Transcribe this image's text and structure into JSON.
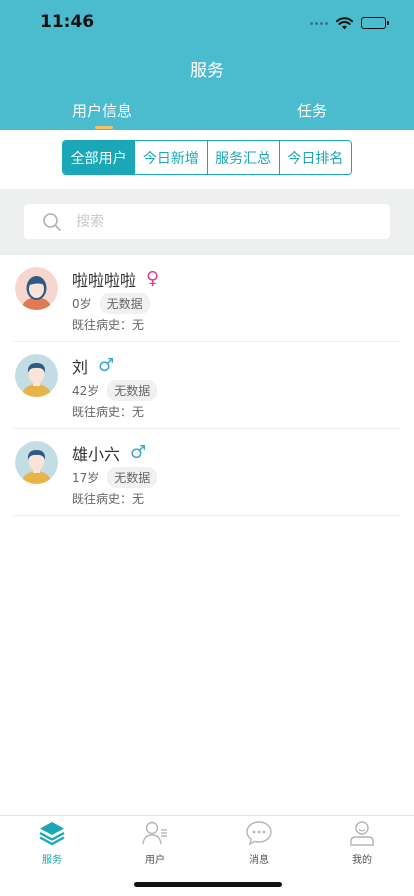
{
  "status_bar": {
    "time": "11:46"
  },
  "nav": {
    "title": "服务"
  },
  "top_tabs": [
    {
      "label": "用户信息",
      "active": true
    },
    {
      "label": "任务",
      "active": false
    }
  ],
  "segments": [
    {
      "label": "全部用户",
      "active": true
    },
    {
      "label": "今日新增",
      "active": false
    },
    {
      "label": "服务汇总",
      "active": false
    },
    {
      "label": "今日排名",
      "active": false
    }
  ],
  "search": {
    "placeholder": "搜索",
    "value": ""
  },
  "users": [
    {
      "name": "啦啦啦啦",
      "gender_symbol": "♀",
      "gender": "female",
      "age": "0岁",
      "badge": "无数据",
      "history": "既往病史：无"
    },
    {
      "name": "刘",
      "gender_symbol": "♂",
      "gender": "male",
      "age": "42岁",
      "badge": "无数据",
      "history": "既往病史：无"
    },
    {
      "name": "雄小六",
      "gender_symbol": "♂",
      "gender": "male",
      "age": "17岁",
      "badge": "无数据",
      "history": "既往病史：无"
    }
  ],
  "tabbar": [
    {
      "label": "服务",
      "icon": "layers-icon",
      "active": true
    },
    {
      "label": "用户",
      "icon": "user-list-icon",
      "active": false
    },
    {
      "label": "消息",
      "icon": "chat-bubble-icon",
      "active": false
    },
    {
      "label": "我的",
      "icon": "person-icon",
      "active": false
    }
  ],
  "colors": {
    "header": "#4bbccd",
    "accent": "#1aa8b8",
    "tab_indicator": "#f5c26b",
    "female": "#e0408c",
    "male": "#3ba7cf"
  }
}
